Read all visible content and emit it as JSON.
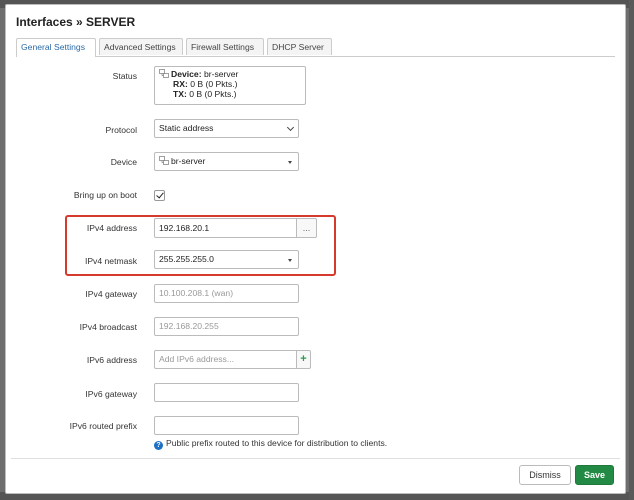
{
  "dialog": {
    "title": "Interfaces » SERVER",
    "tabs": [
      {
        "label": "General Settings",
        "active": true
      },
      {
        "label": "Advanced Settings",
        "active": false
      },
      {
        "label": "Firewall Settings",
        "active": false
      },
      {
        "label": "DHCP Server",
        "active": false
      }
    ]
  },
  "fields": {
    "status": {
      "label": "Status",
      "device_prefix": "Device:",
      "device_name": "br-server",
      "rx_prefix": "RX:",
      "rx_value": "0 B (0 Pkts.)",
      "tx_prefix": "TX:",
      "tx_value": "0 B (0 Pkts.)"
    },
    "protocol": {
      "label": "Protocol",
      "value": "Static address"
    },
    "device": {
      "label": "Device",
      "value": "br-server"
    },
    "boot": {
      "label": "Bring up on boot",
      "checked": true
    },
    "ipv4_address": {
      "label": "IPv4 address",
      "value": "192.168.20.1",
      "addon": "..."
    },
    "ipv4_netmask": {
      "label": "IPv4 netmask",
      "value": "255.255.255.0"
    },
    "ipv4_gateway": {
      "label": "IPv4 gateway",
      "placeholder": "10.100.208.1 (wan)"
    },
    "ipv4_broadcast": {
      "label": "IPv4 broadcast",
      "placeholder": "192.168.20.255"
    },
    "ipv6_address": {
      "label": "IPv6 address",
      "placeholder": "Add IPv6 address...",
      "addon": "+"
    },
    "ipv6_gateway": {
      "label": "IPv6 gateway",
      "value": ""
    },
    "ipv6_prefix": {
      "label": "IPv6 routed prefix",
      "value": "",
      "hint": "Public prefix routed to this device for distribution to clients."
    }
  },
  "footer": {
    "dismiss_label": "Dismiss",
    "save_label": "Save"
  },
  "colors": {
    "highlight": "#d63a2c",
    "save": "#238a45",
    "tab_active_text": "#2a6aa8",
    "help_icon": "#1e6fc6"
  }
}
